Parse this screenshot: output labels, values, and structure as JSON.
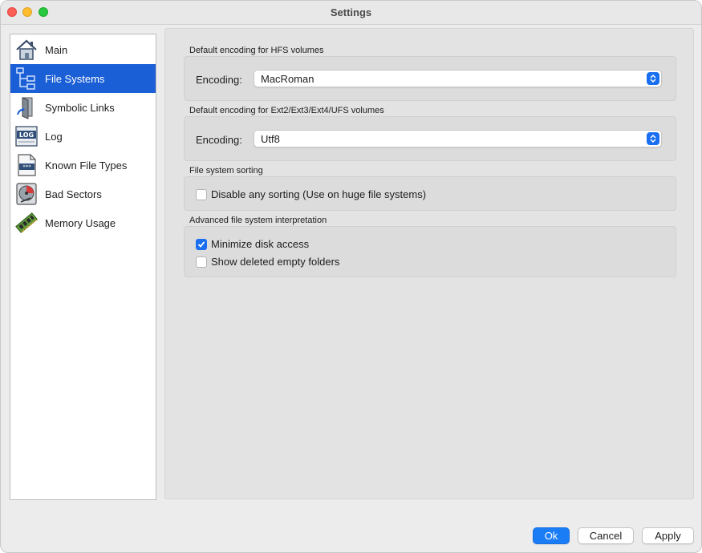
{
  "window": {
    "title": "Settings"
  },
  "sidebar": {
    "items": [
      {
        "label": "Main",
        "icon": "house-icon"
      },
      {
        "label": "File Systems",
        "icon": "tree-icon",
        "selected": true
      },
      {
        "label": "Symbolic Links",
        "icon": "link-icon"
      },
      {
        "label": "Log",
        "icon": "log-icon"
      },
      {
        "label": "Known File Types",
        "icon": "file-types-icon"
      },
      {
        "label": "Bad Sectors",
        "icon": "disk-icon"
      },
      {
        "label": "Memory Usage",
        "icon": "memory-icon"
      }
    ]
  },
  "hfs": {
    "title": "Default encoding for HFS volumes",
    "label": "Encoding:",
    "value": "MacRoman"
  },
  "ext": {
    "title": "Default encoding for Ext2/Ext3/Ext4/UFS volumes",
    "label": "Encoding:",
    "value": "Utf8"
  },
  "sorting": {
    "title": "File system sorting",
    "disable_label": "Disable any sorting (Use on huge file systems)",
    "disable_checked": false
  },
  "advanced": {
    "title": "Advanced file system interpretation",
    "minimize_label": "Minimize disk access",
    "minimize_checked": true,
    "deleted_label": "Show deleted empty folders",
    "deleted_checked": false
  },
  "buttons": {
    "ok": "Ok",
    "cancel": "Cancel",
    "apply": "Apply"
  },
  "colors": {
    "accent": "#1a6ff0",
    "selected_row": "#1a5fd6"
  }
}
